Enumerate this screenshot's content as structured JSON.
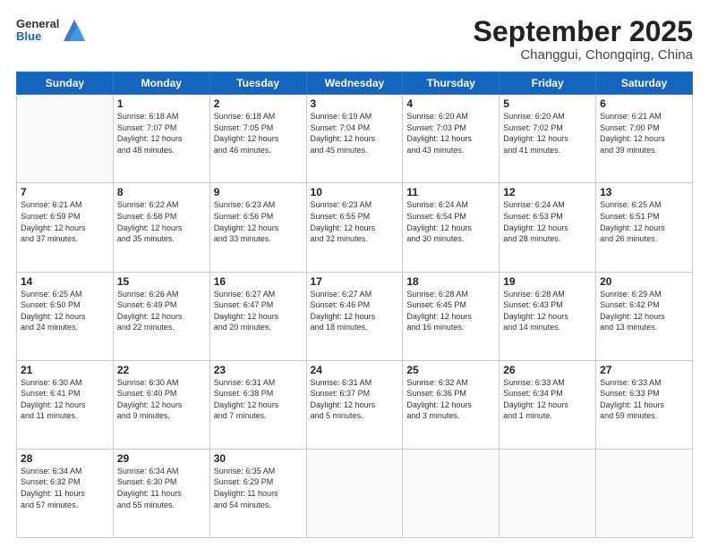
{
  "header": {
    "logo": {
      "general": "General",
      "blue": "Blue"
    },
    "title": "September 2025",
    "subtitle": "Changgui, Chongqing, China"
  },
  "weekdays": [
    "Sunday",
    "Monday",
    "Tuesday",
    "Wednesday",
    "Thursday",
    "Friday",
    "Saturday"
  ],
  "weeks": [
    [
      {
        "day": "",
        "info": ""
      },
      {
        "day": "1",
        "info": "Sunrise: 6:18 AM\nSunset: 7:07 PM\nDaylight: 12 hours\nand 48 minutes."
      },
      {
        "day": "2",
        "info": "Sunrise: 6:18 AM\nSunset: 7:05 PM\nDaylight: 12 hours\nand 46 minutes."
      },
      {
        "day": "3",
        "info": "Sunrise: 6:19 AM\nSunset: 7:04 PM\nDaylight: 12 hours\nand 45 minutes."
      },
      {
        "day": "4",
        "info": "Sunrise: 6:20 AM\nSunset: 7:03 PM\nDaylight: 12 hours\nand 43 minutes."
      },
      {
        "day": "5",
        "info": "Sunrise: 6:20 AM\nSunset: 7:02 PM\nDaylight: 12 hours\nand 41 minutes."
      },
      {
        "day": "6",
        "info": "Sunrise: 6:21 AM\nSunset: 7:00 PM\nDaylight: 12 hours\nand 39 minutes."
      }
    ],
    [
      {
        "day": "7",
        "info": "Sunrise: 6:21 AM\nSunset: 6:59 PM\nDaylight: 12 hours\nand 37 minutes."
      },
      {
        "day": "8",
        "info": "Sunrise: 6:22 AM\nSunset: 6:58 PM\nDaylight: 12 hours\nand 35 minutes."
      },
      {
        "day": "9",
        "info": "Sunrise: 6:23 AM\nSunset: 6:56 PM\nDaylight: 12 hours\nand 33 minutes."
      },
      {
        "day": "10",
        "info": "Sunrise: 6:23 AM\nSunset: 6:55 PM\nDaylight: 12 hours\nand 32 minutes."
      },
      {
        "day": "11",
        "info": "Sunrise: 6:24 AM\nSunset: 6:54 PM\nDaylight: 12 hours\nand 30 minutes."
      },
      {
        "day": "12",
        "info": "Sunrise: 6:24 AM\nSunset: 6:53 PM\nDaylight: 12 hours\nand 28 minutes."
      },
      {
        "day": "13",
        "info": "Sunrise: 6:25 AM\nSunset: 6:51 PM\nDaylight: 12 hours\nand 26 minutes."
      }
    ],
    [
      {
        "day": "14",
        "info": "Sunrise: 6:25 AM\nSunset: 6:50 PM\nDaylight: 12 hours\nand 24 minutes."
      },
      {
        "day": "15",
        "info": "Sunrise: 6:26 AM\nSunset: 6:49 PM\nDaylight: 12 hours\nand 22 minutes."
      },
      {
        "day": "16",
        "info": "Sunrise: 6:27 AM\nSunset: 6:47 PM\nDaylight: 12 hours\nand 20 minutes."
      },
      {
        "day": "17",
        "info": "Sunrise: 6:27 AM\nSunset: 6:46 PM\nDaylight: 12 hours\nand 18 minutes."
      },
      {
        "day": "18",
        "info": "Sunrise: 6:28 AM\nSunset: 6:45 PM\nDaylight: 12 hours\nand 16 minutes."
      },
      {
        "day": "19",
        "info": "Sunrise: 6:28 AM\nSunset: 6:43 PM\nDaylight: 12 hours\nand 14 minutes."
      },
      {
        "day": "20",
        "info": "Sunrise: 6:29 AM\nSunset: 6:42 PM\nDaylight: 12 hours\nand 13 minutes."
      }
    ],
    [
      {
        "day": "21",
        "info": "Sunrise: 6:30 AM\nSunset: 6:41 PM\nDaylight: 12 hours\nand 11 minutes."
      },
      {
        "day": "22",
        "info": "Sunrise: 6:30 AM\nSunset: 6:40 PM\nDaylight: 12 hours\nand 9 minutes."
      },
      {
        "day": "23",
        "info": "Sunrise: 6:31 AM\nSunset: 6:38 PM\nDaylight: 12 hours\nand 7 minutes."
      },
      {
        "day": "24",
        "info": "Sunrise: 6:31 AM\nSunset: 6:37 PM\nDaylight: 12 hours\nand 5 minutes."
      },
      {
        "day": "25",
        "info": "Sunrise: 6:32 AM\nSunset: 6:36 PM\nDaylight: 12 hours\nand 3 minutes."
      },
      {
        "day": "26",
        "info": "Sunrise: 6:33 AM\nSunset: 6:34 PM\nDaylight: 12 hours\nand 1 minute."
      },
      {
        "day": "27",
        "info": "Sunrise: 6:33 AM\nSunset: 6:33 PM\nDaylight: 11 hours\nand 59 minutes."
      }
    ],
    [
      {
        "day": "28",
        "info": "Sunrise: 6:34 AM\nSunset: 6:32 PM\nDaylight: 11 hours\nand 57 minutes."
      },
      {
        "day": "29",
        "info": "Sunrise: 6:34 AM\nSunset: 6:30 PM\nDaylight: 11 hours\nand 55 minutes."
      },
      {
        "day": "30",
        "info": "Sunrise: 6:35 AM\nSunset: 6:29 PM\nDaylight: 11 hours\nand 54 minutes."
      },
      {
        "day": "",
        "info": ""
      },
      {
        "day": "",
        "info": ""
      },
      {
        "day": "",
        "info": ""
      },
      {
        "day": "",
        "info": ""
      }
    ]
  ]
}
